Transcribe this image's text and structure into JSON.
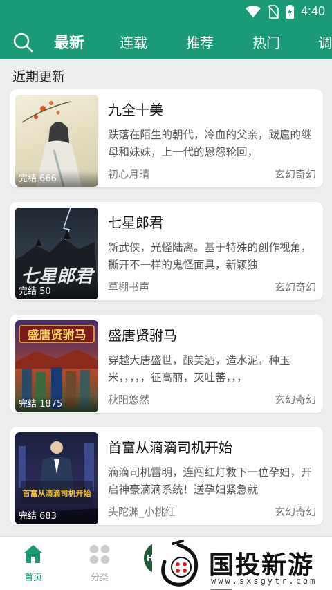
{
  "status_bar": {
    "time": "4:40"
  },
  "top_nav": {
    "tabs": [
      {
        "label": "最新",
        "active": true
      },
      {
        "label": "连载",
        "active": false
      },
      {
        "label": "推荐",
        "active": false
      },
      {
        "label": "热门",
        "active": false
      },
      {
        "label": "调",
        "active": false
      }
    ],
    "accent_color": "#1a9a76"
  },
  "section": {
    "title": "近期更新"
  },
  "books": [
    {
      "title": "九全十美",
      "description": "跌落在陌生的朝代，冷血的父亲，跋扈的继母和妹妹，上一代的恩怨轮回，",
      "author": "初心月晴",
      "genre": "玄幻奇幻",
      "badge": "完结 666"
    },
    {
      "title": "七星郎君",
      "description": "新武侠，光怪陆离。基于特殊的创作视角，撕开不一样的鬼怪面具，新颖独",
      "author": "草棚书声",
      "genre": "玄幻奇幻",
      "badge": "完结 50",
      "cover_text": "七星郎君"
    },
    {
      "title": "盛唐贤驸马",
      "description": "穿越大唐盛世，酿美酒，造水泥，种玉米，，，，，征高丽，灭吐蕃，，，",
      "author": "秋阳悠然",
      "genre": "玄幻奇幻",
      "badge": "完结 1875",
      "cover_text": "盛唐贤驸马"
    },
    {
      "title": "首富从滴滴司机开始",
      "description": "滴滴司机雷明，连闯红灯救下一位孕妇，开启神豪滴滴系统！送孕妇紧急就",
      "author": "头陀渊_小桃红",
      "genre": "玄幻奇幻",
      "badge": "完结 683",
      "cover_text": "首富从滴滴司机开始"
    }
  ],
  "bottom_nav": {
    "items": [
      {
        "label": "首页",
        "active": true
      },
      {
        "label": "分类",
        "active": false
      }
    ],
    "partial_label": "Hai"
  },
  "watermark": {
    "text": "国投新游网",
    "url": "www.sxsgytr.com"
  }
}
